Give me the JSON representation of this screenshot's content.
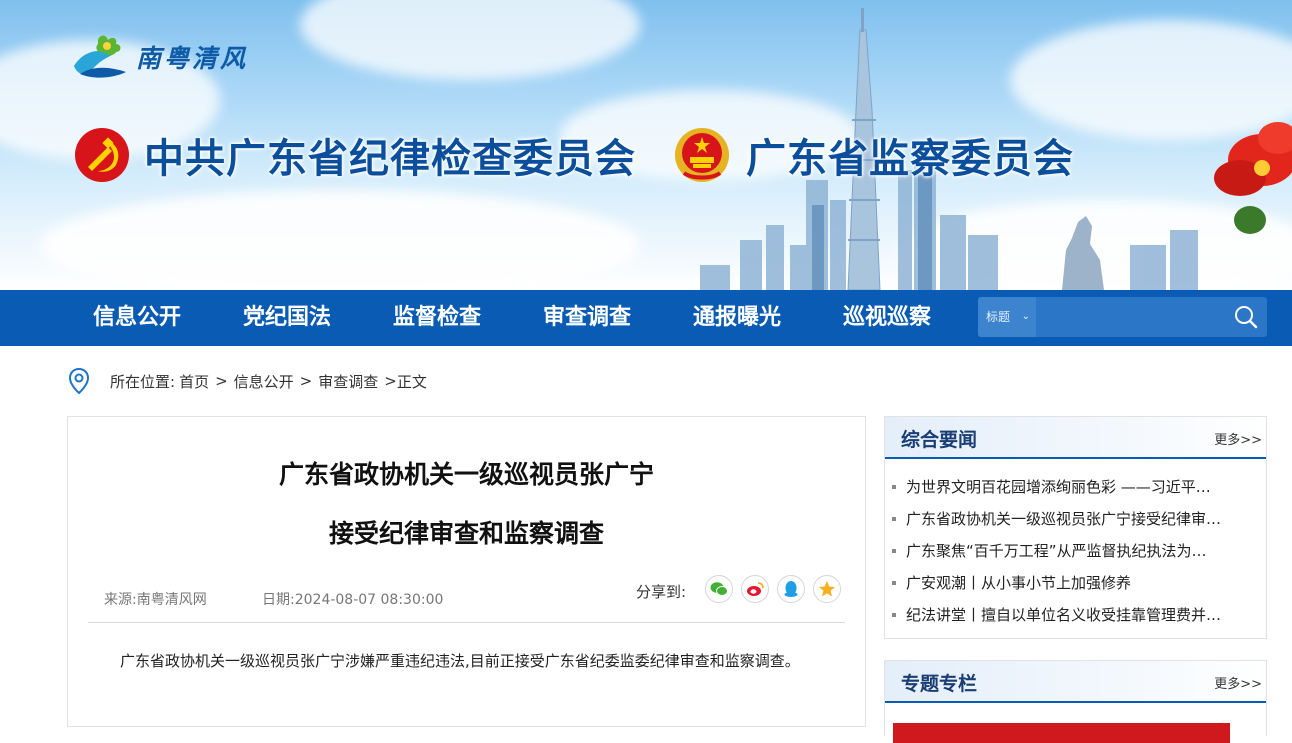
{
  "banner": {
    "logo_text": "南粤清风",
    "org_title_1": "中共广东省纪律检查委员会",
    "org_title_2": "广东省监察委员会"
  },
  "nav": {
    "items": [
      "信息公开",
      "党纪国法",
      "监督检查",
      "审查调查",
      "通报曝光",
      "巡视巡察"
    ]
  },
  "search": {
    "select_value": "标题",
    "placeholder": ""
  },
  "breadcrumb": {
    "label": "所在位置:",
    "items": [
      "首页",
      "信息公开",
      "审查调查"
    ],
    "current": "正文",
    "separator": ">"
  },
  "article": {
    "title_line1": "广东省政协机关一级巡视员张广宁",
    "title_line2": "接受纪律审查和监察调查",
    "source": "来源:南粤清风网",
    "date": "日期:2024-08-07 08:30:00",
    "share_label": "分享到:",
    "body": "广东省政协机关一级巡视员张广宁涉嫌严重违纪违法,目前正接受广东省纪委监委纪律审查和监察调查。"
  },
  "sidebar": {
    "news": {
      "title": "综合要闻",
      "more": "更多>>",
      "items": [
        "为世界文明百花园增添绚丽色彩 ——习近平…",
        "广东省政协机关一级巡视员张广宁接受纪律审…",
        "广东聚焦“百千万工程”从严监督执纪执法为…",
        "广安观潮丨从小事小节上加强修养",
        "纪法讲堂丨擅自以单位名义收受挂靠管理费并…"
      ]
    },
    "special": {
      "title": "专题专栏",
      "more": "更多>>"
    }
  },
  "colors": {
    "nav_bg": "#0a5bb3",
    "title_blue": "#0b4f9c",
    "accent_red": "#d0191f"
  },
  "icons": {
    "share": [
      "wechat-icon",
      "weibo-icon",
      "qq-icon",
      "qzone-icon"
    ]
  }
}
